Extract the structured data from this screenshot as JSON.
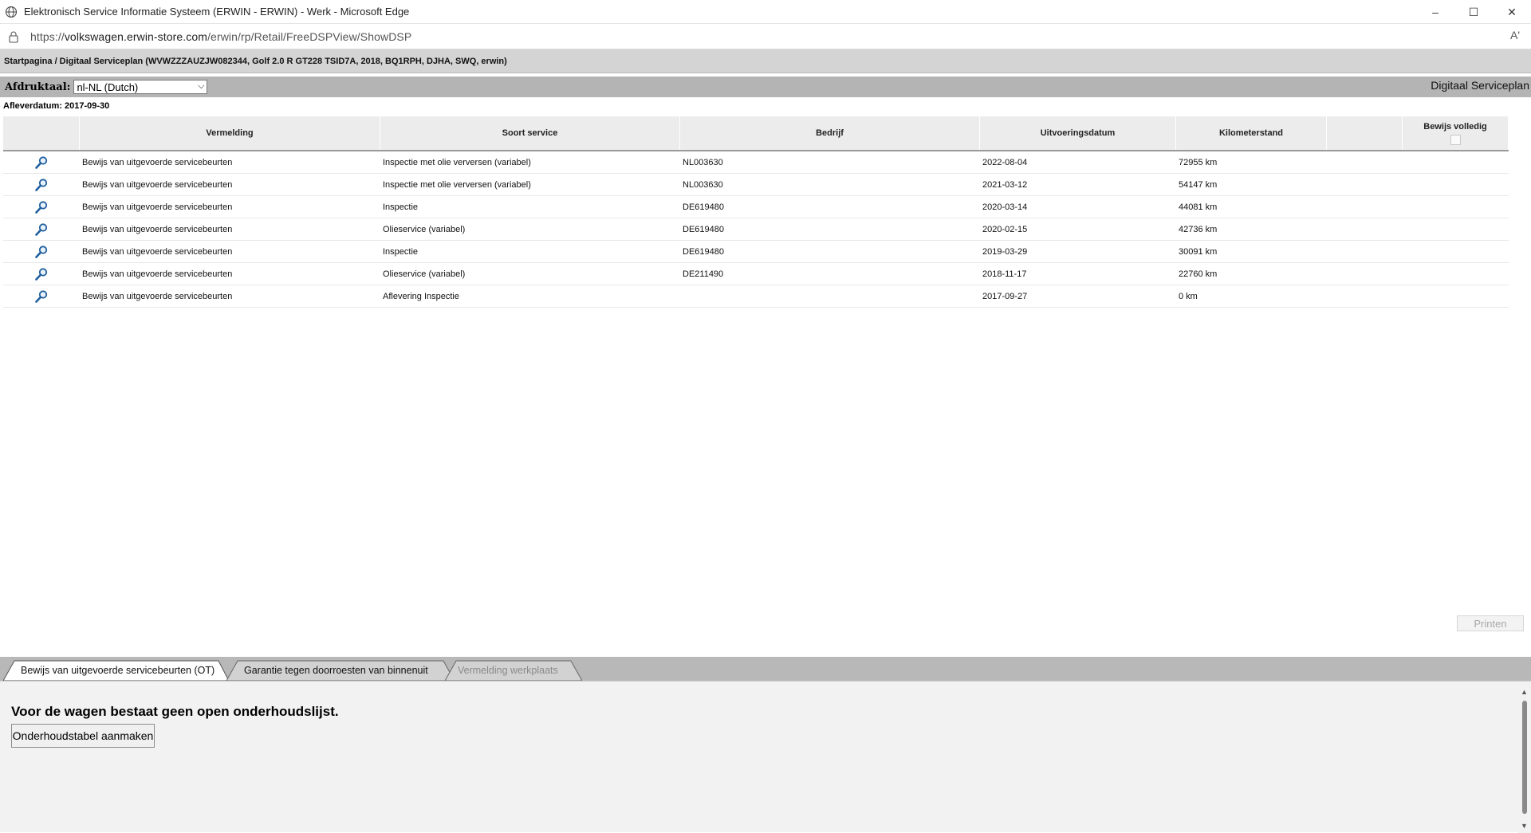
{
  "window": {
    "title": "Elektronisch Service Informatie Systeem (ERWIN - ERWIN) - Werk - Microsoft Edge",
    "minimize": "–",
    "maximize": "☐",
    "close": "✕"
  },
  "address": {
    "url_prefix": "https://",
    "url_host": "volkswagen.erwin-store.com",
    "url_path": "/erwin/rp/Retail/FreeDSPView/ShowDSP",
    "read_aloud": "Aʹ"
  },
  "breadcrumb": "Startpagina / Digitaal Serviceplan (WVWZZZAUZJW082344, Golf 2.0 R GT228 TSID7A, 2018, BQ1RPH, DJHA, SWQ, erwin)",
  "langbar": {
    "label": "Afdruktaal:",
    "selected": "nl-NL (Dutch)",
    "page_title": "Digitaal Serviceplan"
  },
  "delivery_date": "Afleverdatum: 2017-09-30",
  "table": {
    "headers": {
      "vermelding": "Vermelding",
      "soort_service": "Soort service",
      "bedrijf": "Bedrijf",
      "uitvoeringsdatum": "Uitvoeringsdatum",
      "kilometerstand": "Kilometerstand",
      "empty": "",
      "bewijs_volledig": "Bewijs volledig"
    },
    "rows": [
      {
        "vermelding": "Bewijs van uitgevoerde servicebeurten",
        "soort": "Inspectie met olie verversen (variabel)",
        "bedrijf": "NL003630",
        "datum": "2022-08-04",
        "km": "72955 km"
      },
      {
        "vermelding": "Bewijs van uitgevoerde servicebeurten",
        "soort": "Inspectie met olie verversen (variabel)",
        "bedrijf": "NL003630",
        "datum": "2021-03-12",
        "km": "54147 km"
      },
      {
        "vermelding": "Bewijs van uitgevoerde servicebeurten",
        "soort": "Inspectie",
        "bedrijf": "DE619480",
        "datum": "2020-03-14",
        "km": "44081 km"
      },
      {
        "vermelding": "Bewijs van uitgevoerde servicebeurten",
        "soort": "Olieservice (variabel)",
        "bedrijf": "DE619480",
        "datum": "2020-02-15",
        "km": "42736 km"
      },
      {
        "vermelding": "Bewijs van uitgevoerde servicebeurten",
        "soort": "Inspectie",
        "bedrijf": "DE619480",
        "datum": "2019-03-29",
        "km": "30091 km"
      },
      {
        "vermelding": "Bewijs van uitgevoerde servicebeurten",
        "soort": "Olieservice (variabel)",
        "bedrijf": "DE211490",
        "datum": "2018-11-17",
        "km": "22760 km"
      },
      {
        "vermelding": "Bewijs van uitgevoerde servicebeurten",
        "soort": "Aflevering Inspectie",
        "bedrijf": "",
        "datum": "2017-09-27",
        "km": "0 km"
      }
    ]
  },
  "print_button": "Printen",
  "tabs": [
    {
      "label": "Bewijs van uitgevoerde servicebeurten (OT)",
      "active": true
    },
    {
      "label": "Garantie tegen doorroesten van binnenuit",
      "active": false
    },
    {
      "label": "Vermelding werkplaats",
      "active": false,
      "disabled": true
    }
  ],
  "panel": {
    "message": "Voor de wagen bestaat geen open onderhoudslijst.",
    "create_button": "Onderhoudstabel aanmaken"
  },
  "colors": {
    "breadcrumb_bg": "#d4d4d4",
    "toolbar_bg": "#b4b4b4",
    "tabbar_bg": "#b8b8b8",
    "icon_blue": "#1f5f9e"
  },
  "icons": {
    "row_icon": "magnifier-icon",
    "title_icon": "globe-icon",
    "address_icon": "lock-icon"
  }
}
